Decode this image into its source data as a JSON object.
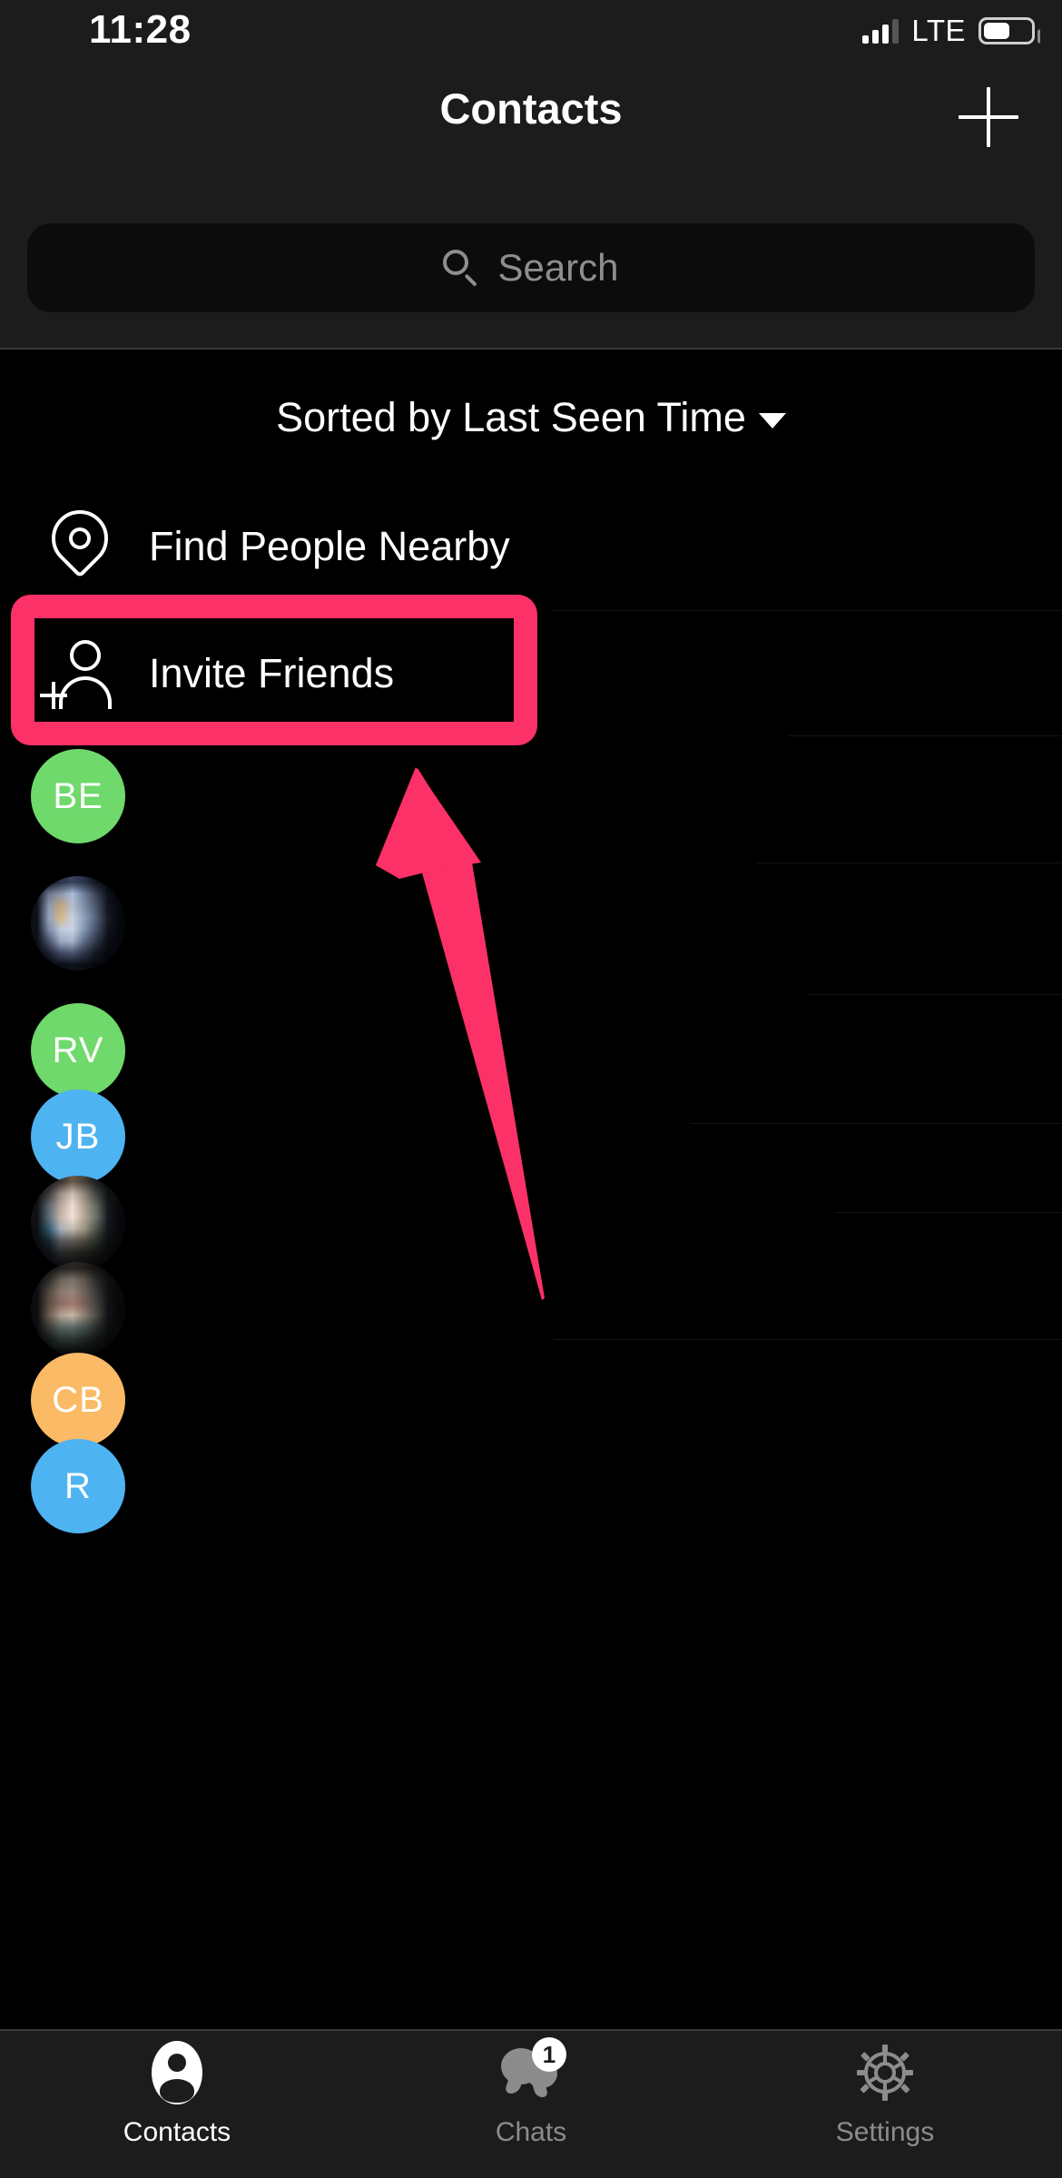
{
  "status_bar": {
    "time": "11:28",
    "network": "LTE",
    "signal_bars_filled": 3,
    "signal_bars_total": 4,
    "battery_percent": 52
  },
  "nav": {
    "title": "Contacts",
    "add_icon": "plus-icon"
  },
  "search": {
    "placeholder": "Search",
    "value": "",
    "icon": "search-icon"
  },
  "sort": {
    "label": "Sorted by Last Seen Time",
    "caret_icon": "chevron-down-icon"
  },
  "actions": [
    {
      "id": "find-people-nearby",
      "label": "Find People Nearby",
      "icon": "map-pin-icon"
    },
    {
      "id": "invite-friends",
      "label": "Invite Friends",
      "icon": "person-add-icon"
    }
  ],
  "highlight": {
    "target": "Invite Friends",
    "color": "#fb3167",
    "shape": "rounded-rectangle-with-arrow"
  },
  "contacts": [
    {
      "initials": "BE",
      "type": "initials",
      "color": "#6fd96b"
    },
    {
      "initials": "",
      "type": "photo",
      "color": "#8fa3c0"
    },
    {
      "initials": "RV",
      "type": "initials",
      "color": "#6fd96b"
    },
    {
      "initials": "JB",
      "type": "initials",
      "color": "#4eb3f1"
    },
    {
      "initials": "",
      "type": "photo",
      "color": "#b9a99a"
    },
    {
      "initials": "",
      "type": "photo",
      "color": "#7a6258"
    },
    {
      "initials": "CB",
      "type": "initials",
      "color": "#fbba66"
    },
    {
      "initials": "R",
      "type": "initials",
      "color": "#4eb3f1"
    }
  ],
  "tabs": [
    {
      "id": "contacts",
      "label": "Contacts",
      "icon": "person-circle-icon",
      "active": true,
      "badge": ""
    },
    {
      "id": "chats",
      "label": "Chats",
      "icon": "chat-bubbles-icon",
      "active": false,
      "badge": "1"
    },
    {
      "id": "settings",
      "label": "Settings",
      "icon": "gear-icon",
      "active": false,
      "badge": ""
    }
  ],
  "colors": {
    "accent_highlight": "#fb3167",
    "bar_background": "#1c1c1c",
    "list_background": "#000000",
    "search_background": "#0c0c0c",
    "muted_text": "#8c8c8c"
  }
}
